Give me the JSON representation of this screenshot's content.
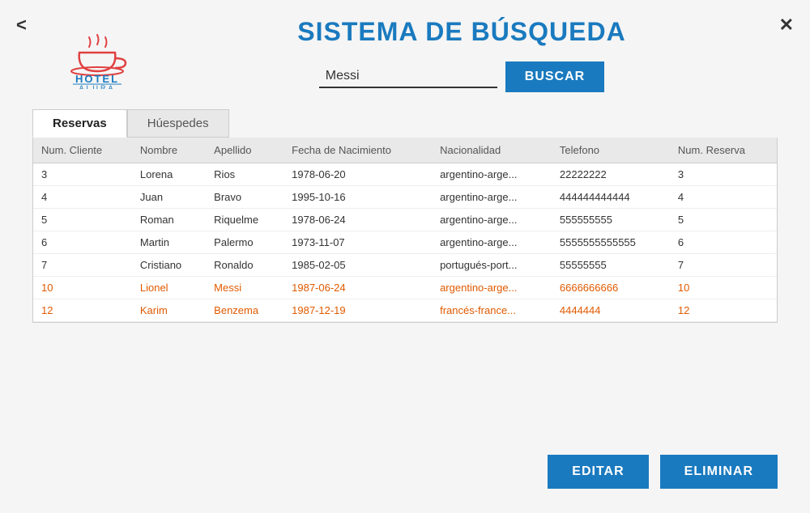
{
  "nav": {
    "back_label": "<",
    "close_label": "✕"
  },
  "title": "SISTEMA DE BÚSQUEDA",
  "search": {
    "value": "Messi",
    "placeholder": "",
    "button_label": "BUSCAR"
  },
  "tabs": [
    {
      "id": "reservas",
      "label": "Reservas",
      "active": true
    },
    {
      "id": "huespedes",
      "label": "Húespedes",
      "active": false
    }
  ],
  "table": {
    "columns": [
      "Num. Cliente",
      "Nombre",
      "Apellido",
      "Fecha de Nacimiento",
      "Nacionalidad",
      "Telefono",
      "Num. Reserva"
    ],
    "rows": [
      {
        "num_cliente": "3",
        "nombre": "Lorena",
        "apellido": "Rios",
        "fecha": "1978-06-20",
        "nacionalidad": "argentino-arge...",
        "telefono": "22222222",
        "num_reserva": "3",
        "highlight": false
      },
      {
        "num_cliente": "4",
        "nombre": "Juan",
        "apellido": "Bravo",
        "fecha": "1995-10-16",
        "nacionalidad": "argentino-arge...",
        "telefono": "444444444444",
        "num_reserva": "4",
        "highlight": false
      },
      {
        "num_cliente": "5",
        "nombre": "Roman",
        "apellido": "Riquelme",
        "fecha": "1978-06-24",
        "nacionalidad": "argentino-arge...",
        "telefono": "555555555",
        "num_reserva": "5",
        "highlight": false
      },
      {
        "num_cliente": "6",
        "nombre": "Martin",
        "apellido": "Palermo",
        "fecha": "1973-11-07",
        "nacionalidad": "argentino-arge...",
        "telefono": "5555555555555",
        "num_reserva": "6",
        "highlight": false
      },
      {
        "num_cliente": "7",
        "nombre": "Cristiano",
        "apellido": "Ronaldo",
        "fecha": "1985-02-05",
        "nacionalidad": "portugués-port...",
        "telefono": "55555555",
        "num_reserva": "7",
        "highlight": false
      },
      {
        "num_cliente": "10",
        "nombre": "Lionel",
        "apellido": "Messi",
        "fecha": "1987-06-24",
        "nacionalidad": "argentino-arge...",
        "telefono": "6666666666",
        "num_reserva": "10",
        "highlight": true
      },
      {
        "num_cliente": "12",
        "nombre": "Karim",
        "apellido": "Benzema",
        "fecha": "1987-12-19",
        "nacionalidad": "francés-france...",
        "telefono": "4444444",
        "num_reserva": "12",
        "highlight": true
      }
    ]
  },
  "footer": {
    "edit_label": "EDITAR",
    "delete_label": "ELIMINAR"
  }
}
